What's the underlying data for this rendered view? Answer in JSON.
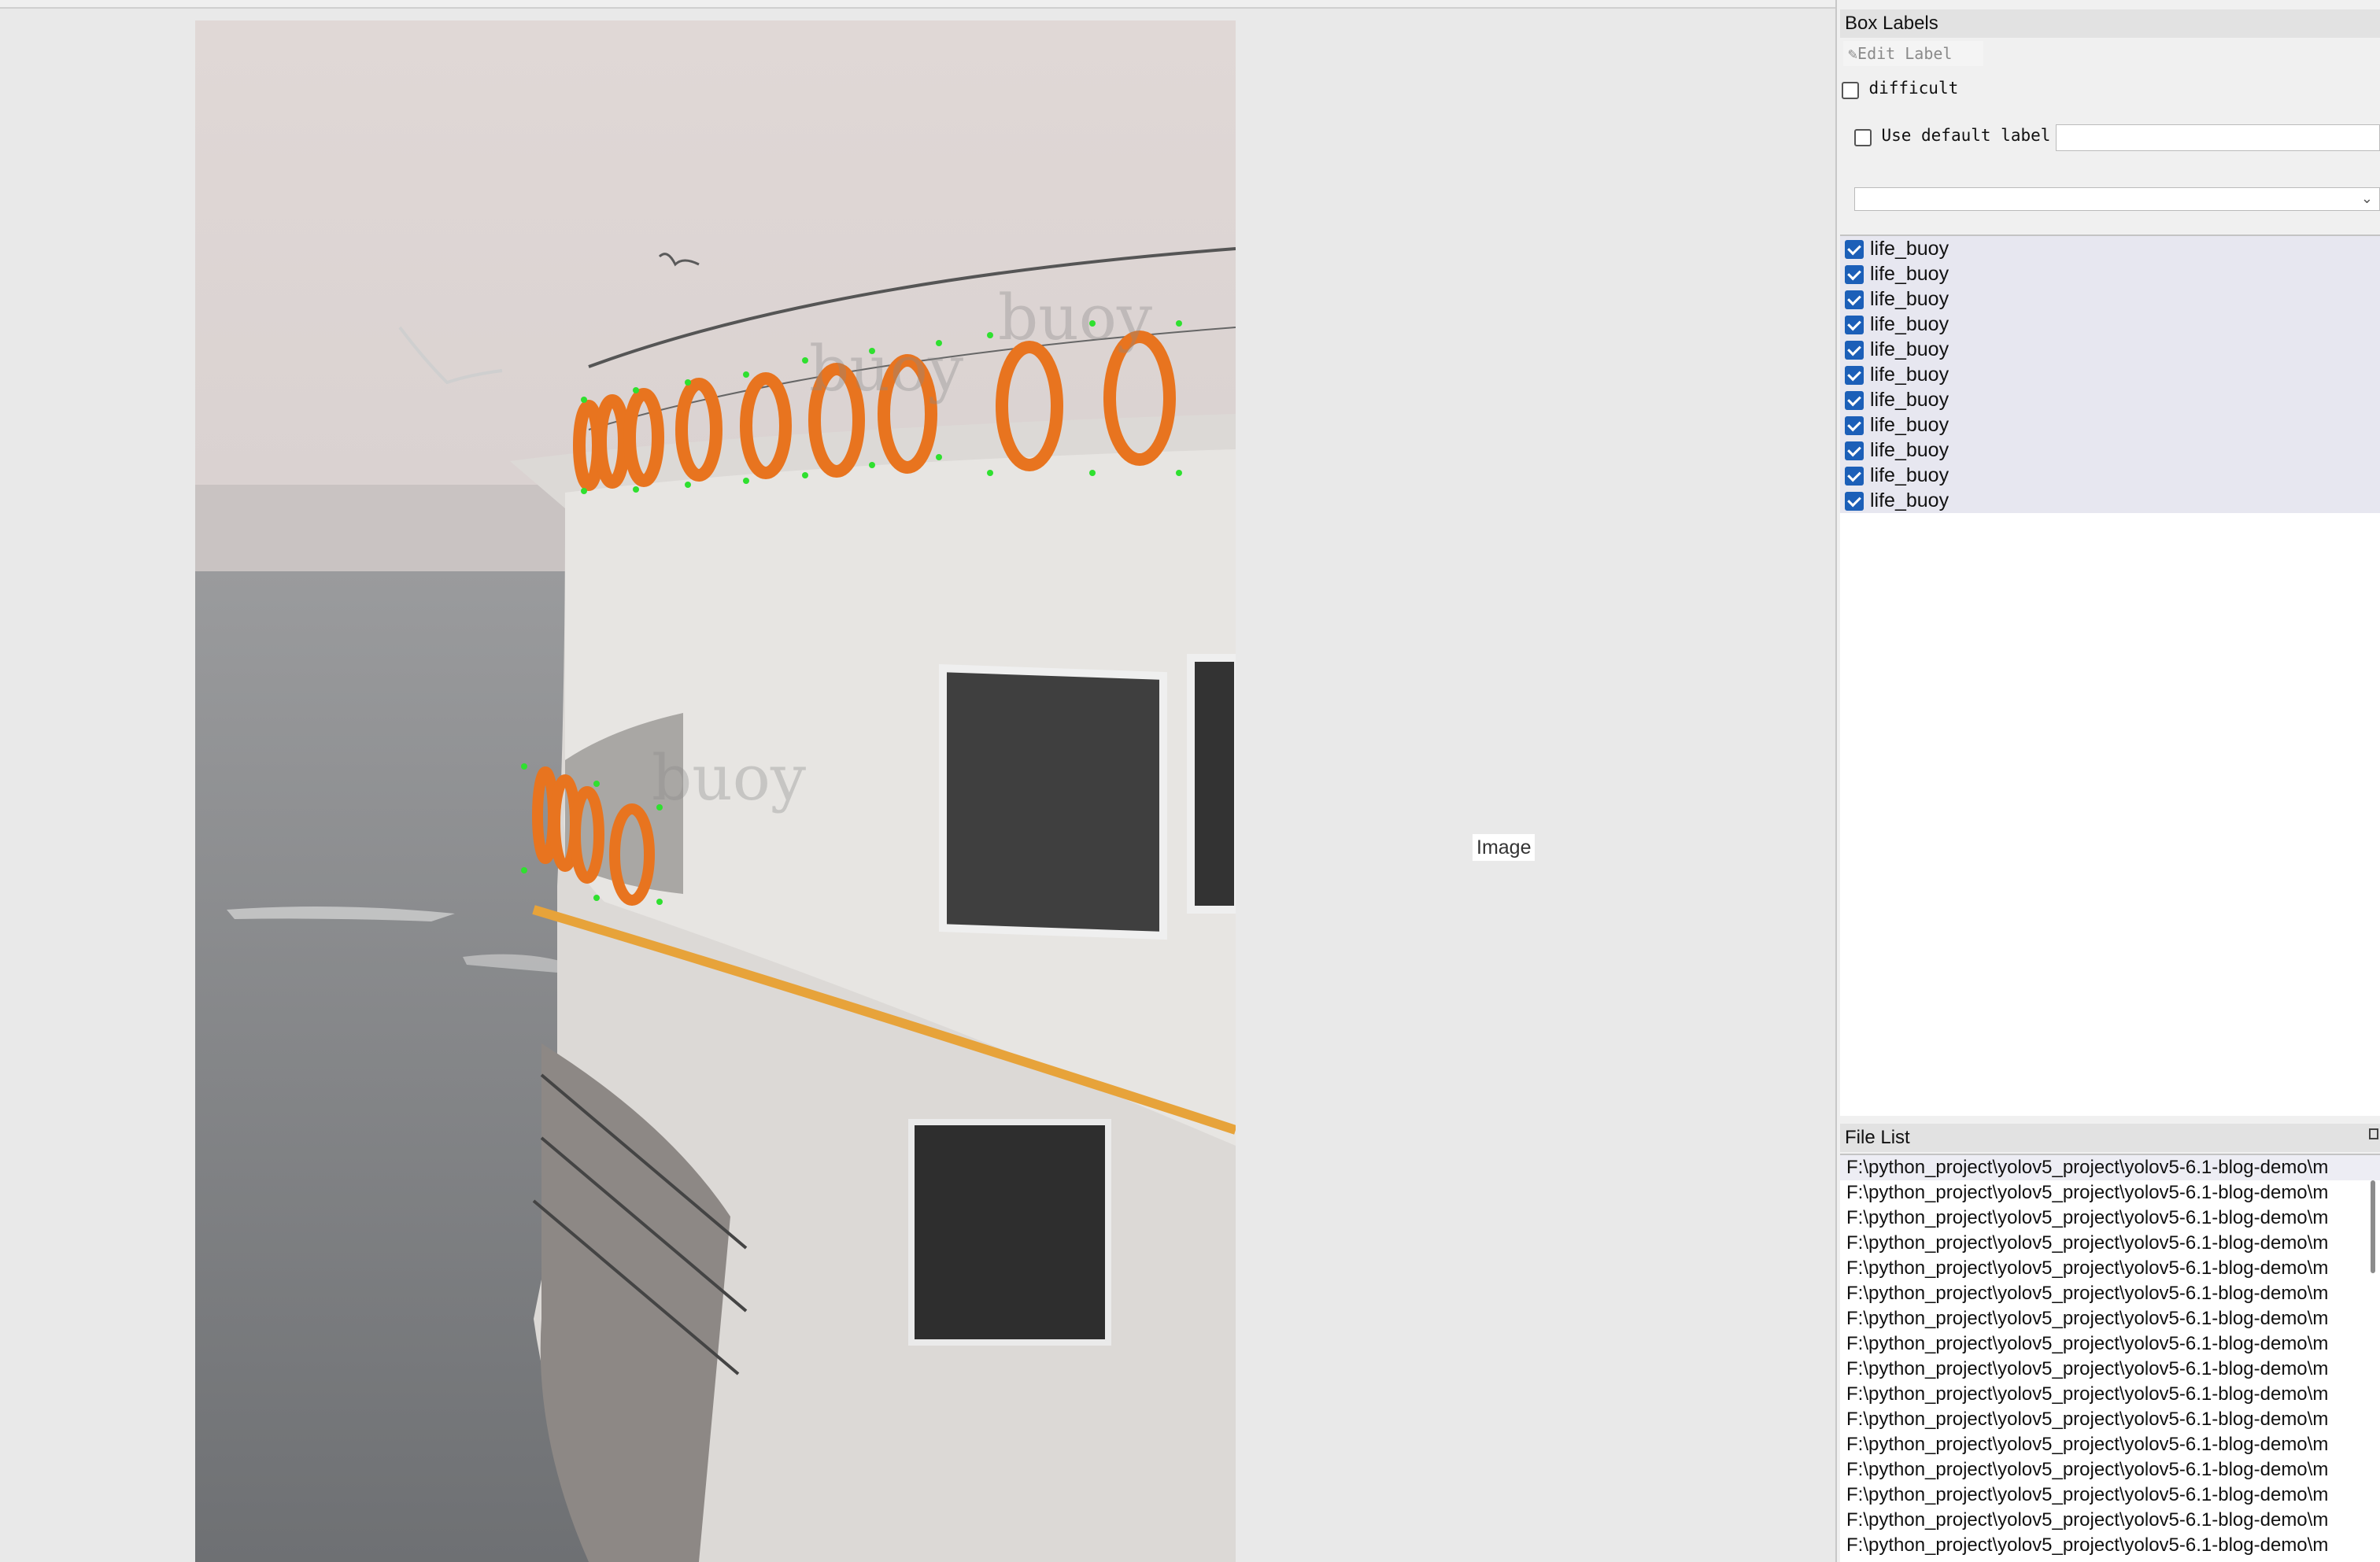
{
  "canvas": {
    "image_label": "Image"
  },
  "box_labels_panel": {
    "title": "Box Labels",
    "edit_label_button": "Edit Label",
    "difficult_label": "difficult",
    "use_default_label": "Use default label",
    "default_label_value": "",
    "label_combo_value": "",
    "labels": [
      "life_buoy",
      "life_buoy",
      "life_buoy",
      "life_buoy",
      "life_buoy",
      "life_buoy",
      "life_buoy",
      "life_buoy",
      "life_buoy",
      "life_buoy",
      "life_buoy"
    ]
  },
  "file_list_panel": {
    "title": "File List",
    "files": [
      "F:\\python_project\\yolov5_project\\yolov5-6.1-blog-demo\\m",
      "F:\\python_project\\yolov5_project\\yolov5-6.1-blog-demo\\m",
      "F:\\python_project\\yolov5_project\\yolov5-6.1-blog-demo\\m",
      "F:\\python_project\\yolov5_project\\yolov5-6.1-blog-demo\\m",
      "F:\\python_project\\yolov5_project\\yolov5-6.1-blog-demo\\m",
      "F:\\python_project\\yolov5_project\\yolov5-6.1-blog-demo\\m",
      "F:\\python_project\\yolov5_project\\yolov5-6.1-blog-demo\\m",
      "F:\\python_project\\yolov5_project\\yolov5-6.1-blog-demo\\m",
      "F:\\python_project\\yolov5_project\\yolov5-6.1-blog-demo\\m",
      "F:\\python_project\\yolov5_project\\yolov5-6.1-blog-demo\\m",
      "F:\\python_project\\yolov5_project\\yolov5-6.1-blog-demo\\m",
      "F:\\python_project\\yolov5_project\\yolov5-6.1-blog-demo\\m",
      "F:\\python_project\\yolov5_project\\yolov5-6.1-blog-demo\\m",
      "F:\\python_project\\yolov5_project\\yolov5-6.1-blog-demo\\m",
      "F:\\python_project\\yolov5_project\\yolov5-6.1-blog-demo\\m",
      "F:\\python_project\\yolov5_project\\yolov5-6.1-blog-demo\\m"
    ]
  },
  "colors": {
    "checkbox_blue": "#1c5fb8",
    "annotation_point": "#2fe02f",
    "life_buoy_orange": "#e8741f"
  }
}
